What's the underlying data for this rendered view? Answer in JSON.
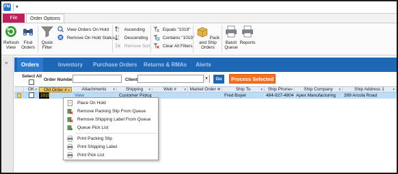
{
  "titlebar": {
    "app_icon": "FM",
    "qat_arrow": "▾"
  },
  "ribbon_tabs": {
    "file": "File",
    "active": "Order Options"
  },
  "ribbon": {
    "refresh": "Refresh View",
    "find": "Find Orders",
    "quick_filter": "Quick Filter",
    "view_on_hold": "View Orders On Hold",
    "remove_on_hold": "Remove On Hold Status",
    "ascending": "Ascending",
    "descending": "Descending",
    "remove_sort": "Remove Sort",
    "equals": "Equals \"1019\"",
    "contains": "Contains \"1019\"",
    "clear_filters": "Clear All Filters",
    "pack_ship": "Pack and Ship Orders",
    "batch_queue": "Batch Queue",
    "reports": "Reports"
  },
  "nav": {
    "items": [
      "Orders",
      "Inventory",
      "Purchase Orders",
      "Returns & RMAs",
      "Alerts"
    ]
  },
  "filters": {
    "select_all": "Select All",
    "order_number_label": "Order Number",
    "client_label": "Client",
    "go": "Go",
    "process_selected": "Process Selected"
  },
  "grid": {
    "headers": [
      "OK",
      "Old Order #",
      "Attachments",
      "Shipping",
      "Web #",
      "Market Order #",
      "Ship To",
      "Ship Phone",
      "Ship Company",
      "Ship Address 1"
    ],
    "rows": [
      {
        "order_no": "1019",
        "attachments": "View",
        "shipping": "Customer Pickup",
        "web": "",
        "market_order": "",
        "ship_to": "Fred Buyer",
        "ship_phone": "484-927-4804",
        "ship_company": "Apex Manufacturing",
        "ship_address": "399 Arcola Road"
      }
    ]
  },
  "context_menu": {
    "items": [
      "Place On Hold",
      "Remove Packing Slip From Queue",
      "Remove Shipping Label From Queue",
      "Queue Pick List",
      "Print Packing Slip",
      "Print Shipping Label",
      "Print Pick List"
    ]
  },
  "colors": {
    "file_tab": "#c0205a",
    "nav_bar": "#1e67b5",
    "process_button": "#f57120",
    "selected_row": "#bcdcf6",
    "order_highlight": "#f6c85a"
  }
}
